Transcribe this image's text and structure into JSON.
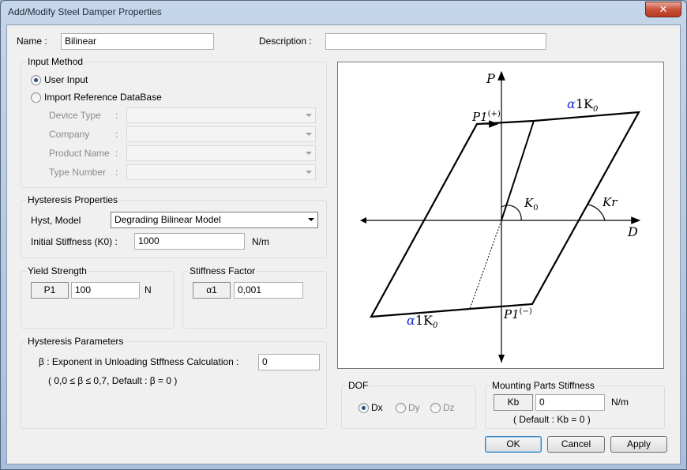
{
  "window": {
    "title": "Add/Modify Steel Damper Properties",
    "close_glyph": "✕"
  },
  "name": {
    "label": "Name :",
    "value": "Bilinear"
  },
  "description": {
    "label": "Description :",
    "value": ""
  },
  "input_method": {
    "title": "Input Method",
    "user_input": "User Input",
    "import_db": "Import Reference DataBase",
    "selected": "User Input",
    "fields": [
      {
        "label": "Device Type",
        "colon": ":",
        "value": ""
      },
      {
        "label": "Company",
        "colon": ":",
        "value": ""
      },
      {
        "label": "Product Name",
        "colon": ":",
        "value": ""
      },
      {
        "label": "Type Number",
        "colon": ":",
        "value": ""
      }
    ]
  },
  "hysteresis_properties": {
    "title": "Hysteresis Properties",
    "model_label": "Hyst, Model",
    "model_value": "Degrading Bilinear Model",
    "stiffness_label": "Initial Stiffness (K0) :",
    "stiffness_value": "1000",
    "stiffness_unit": "N/m"
  },
  "yield_strength": {
    "title": "Yield Strength",
    "symbol": "P1",
    "value": "100",
    "unit": "N"
  },
  "stiffness_factor": {
    "title": "Stiffness Factor",
    "symbol": "α1",
    "value": "0,001"
  },
  "hysteresis_parameters": {
    "title": "Hysteresis Parameters",
    "beta_label": "β : Exponent in Unloading Stffness Calculation :",
    "beta_value": "0",
    "note": "( 0,0 ≤ β ≤ 0,7, Default : β = 0 )"
  },
  "graph": {
    "axis_p": "P",
    "axis_d": "D",
    "p1_plus": "P1",
    "p1_plus_sup": "(+)",
    "p1_minus": "P1",
    "p1_minus_sup": "(−)",
    "alpha_top": "α",
    "alpha_top_rest": "1K",
    "alpha_top_sub": "0",
    "alpha_bot": "α",
    "alpha_bot_rest": "1K",
    "alpha_bot_sub": "0",
    "k0": "K",
    "k0_sub": "0",
    "kr": "Kr",
    "alpha_color": "#1a2fd6"
  },
  "dof": {
    "title": "DOF",
    "options": [
      "Dx",
      "Dy",
      "Dz"
    ],
    "selected": "Dx"
  },
  "mounting": {
    "title": "Mounting Parts Stiffness",
    "symbol": "Kb",
    "value": "0",
    "unit": "N/m",
    "note": "( Default : Kb = 0 )"
  },
  "buttons": {
    "ok": "OK",
    "cancel": "Cancel",
    "apply": "Apply"
  }
}
